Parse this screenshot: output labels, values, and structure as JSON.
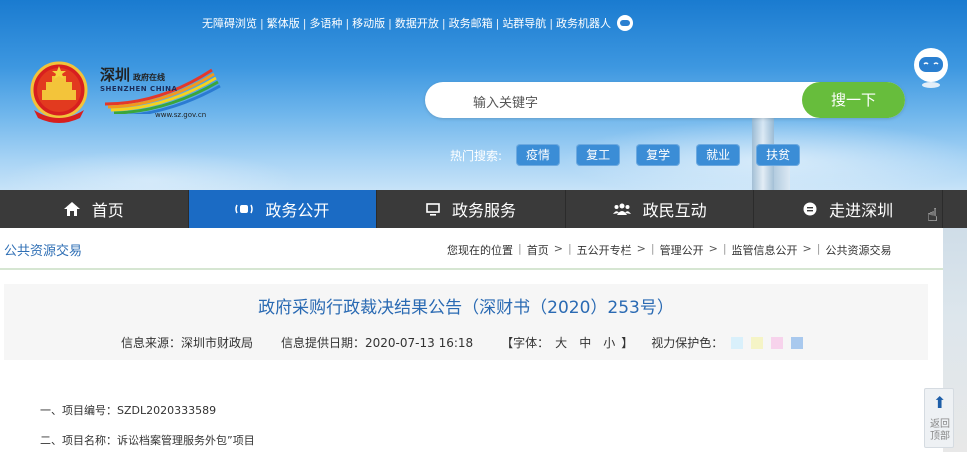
{
  "toplinks": [
    "无障碍浏览",
    "繁体版",
    "多语种",
    "移动版",
    "数据开放",
    "政务邮箱",
    "站群导航",
    "政务机器人"
  ],
  "logo": {
    "cn": "深圳",
    "cn_small": "政府在线",
    "en": "SHENZHEN CHINA",
    "url": "www.sz.gov.cn"
  },
  "search": {
    "placeholder": "输入关键字",
    "button": "搜一下"
  },
  "hot": {
    "label": "热门搜索:",
    "tags": [
      "疫情",
      "复工",
      "复学",
      "就业",
      "扶贫"
    ]
  },
  "nav": [
    {
      "label": "首页",
      "icon": "home-icon"
    },
    {
      "label": "政务公开",
      "icon": "broadcast-icon"
    },
    {
      "label": "政务服务",
      "icon": "monitor-icon"
    },
    {
      "label": "政民互动",
      "icon": "people-icon"
    },
    {
      "label": "走进深圳",
      "icon": "info-circle-icon"
    }
  ],
  "section_title": "公共资源交易",
  "breadcrumb": {
    "prefix": "您现在的位置",
    "items": [
      "首页",
      "五公开专栏",
      "管理公开",
      "监管信息公开",
      "公共资源交易"
    ]
  },
  "article": {
    "title": "政府采购行政裁决结果公告（深财书（2020）253号）",
    "source_label": "信息来源：深圳市财政局",
    "date_label": "信息提供日期：2020-07-13 16:18",
    "font_label": "【字体：",
    "font_sizes": [
      "大",
      "中",
      "小"
    ],
    "font_close": "】",
    "eye_label": "视力保护色：",
    "eye_colors": [
      "#d9f0fb",
      "#f5f4c6",
      "#f7d3ec",
      "#a9c9ee"
    ]
  },
  "body": [
    "一、项目编号：SZDL2020333589",
    "二、项目名称：诉讼档案管理服务外包”项目"
  ],
  "back_top": {
    "arrow": "⬆",
    "label": "返回顶部"
  },
  "colors": {
    "nav_active": "#1b6bc4",
    "nav_bg": "#3a3a3a",
    "search_btn": "#67bd3c",
    "title": "#2a6ab3"
  }
}
